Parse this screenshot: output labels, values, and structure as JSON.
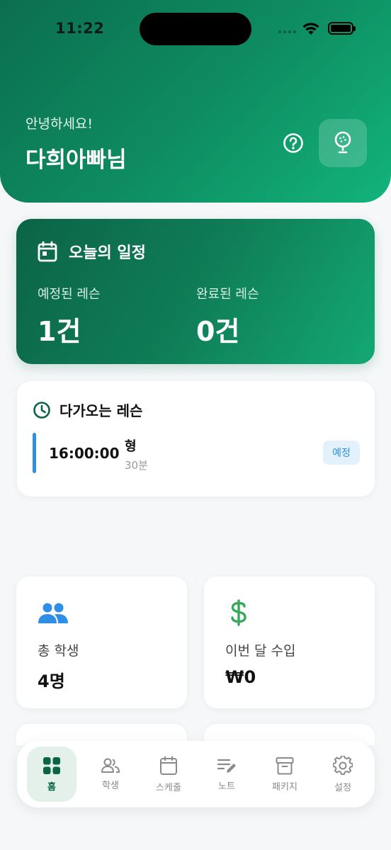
{
  "status_bar": {
    "time": "11:22"
  },
  "header": {
    "greeting": "안녕하세요!",
    "username": "다희아빠님",
    "help_icon": "help-circle-icon",
    "profile_icon": "golf-ball-icon",
    "gradient_start": "#0b6e4f",
    "gradient_end": "#12b47c"
  },
  "today": {
    "title": "오늘의 일정",
    "icon": "calendar-icon",
    "scheduled_label": "예정된 레슨",
    "scheduled_value": "1건",
    "completed_label": "완료된 레슨",
    "completed_value": "0건"
  },
  "upcoming": {
    "title": "다가오는 레슨",
    "icon": "clock-icon",
    "lessons": [
      {
        "time": "16:00:00",
        "student": "형",
        "duration": "30분",
        "status": "예정",
        "accent": "#2f8fe6"
      }
    ]
  },
  "stats": [
    {
      "label": "총 학생",
      "value": "4명",
      "icon": "people-icon",
      "color": "#2f8fe6"
    },
    {
      "label": "이번 달 수입",
      "value": "₩0",
      "icon": "dollar-icon",
      "color": "#3aa85a"
    }
  ],
  "nav": {
    "items": [
      {
        "label": "홈",
        "icon": "grid-icon",
        "active": true
      },
      {
        "label": "학생",
        "icon": "people-icon",
        "active": false
      },
      {
        "label": "스케줄",
        "icon": "calendar-icon",
        "active": false
      },
      {
        "label": "노트",
        "icon": "note-icon",
        "active": false
      },
      {
        "label": "패키지",
        "icon": "archive-icon",
        "active": false
      },
      {
        "label": "설정",
        "icon": "gear-icon",
        "active": false
      }
    ]
  }
}
